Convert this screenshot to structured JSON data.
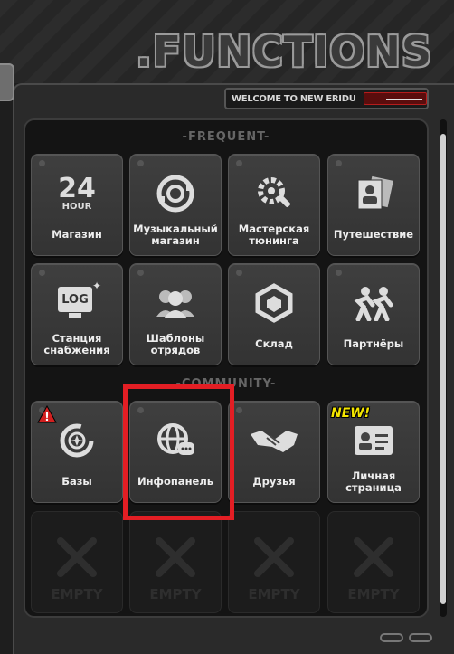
{
  "header": {
    "title": ".FUNCTIONS",
    "welcome_text": "WELCOME TO NEW ERIDU"
  },
  "sections": {
    "frequent": "-FREQUENT-",
    "community": "-COMMUNITY-"
  },
  "tiles": {
    "shops": {
      "label": "Магазин",
      "icon_text": "24",
      "icon_sub": "HOUR"
    },
    "music_shop": {
      "label": "Музыкальный магазин"
    },
    "tuning": {
      "label": "Мастерская тюнинга"
    },
    "travel": {
      "label": "Путешествие"
    },
    "supply": {
      "label": "Станция снабжения",
      "icon_text": "LOG"
    },
    "squads": {
      "label": "Шаблоны отрядов"
    },
    "warehouse": {
      "label": "Склад"
    },
    "partners": {
      "label": "Партнёры"
    },
    "bases": {
      "label": "Базы"
    },
    "infopanel": {
      "label": "Инфопанель"
    },
    "friends": {
      "label": "Друзья"
    },
    "profile": {
      "label": "Личная страница"
    },
    "empty_label": "EMPTY"
  },
  "badges": {
    "new": "NEW!",
    "warning": "!"
  },
  "colors": {
    "highlight": "#e31e24",
    "new_badge": "#f4e600",
    "warning": "#d32020"
  }
}
